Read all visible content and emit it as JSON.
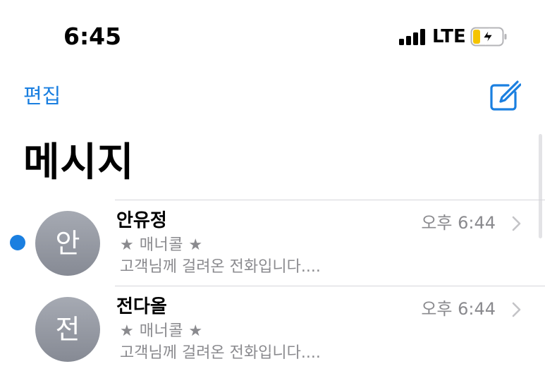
{
  "status_bar": {
    "time": "6:45",
    "carrier": "LTE",
    "signal_bars": 4,
    "battery_icon": "battery-charging-icon"
  },
  "nav": {
    "edit_label": "편집",
    "compose_icon": "compose-icon",
    "title": "메시지"
  },
  "colors": {
    "accent": "#1a7fe0",
    "secondary_text": "#8a8a8e",
    "avatar": "#9a9ea7",
    "battery_charge": "#f5c400"
  },
  "threads": [
    {
      "avatar_initial": "안",
      "sender": "안유정",
      "time": "오후 6:44",
      "subject": "★ 매너콜 ★",
      "preview": "고객님께 걸려온 전화입니다....",
      "unread": true
    },
    {
      "avatar_initial": "전",
      "sender": "전다올",
      "time": "오후 6:44",
      "subject": "★ 매너콜 ★",
      "preview": "고객님께 걸려온 전화입니다....",
      "unread": false
    }
  ]
}
